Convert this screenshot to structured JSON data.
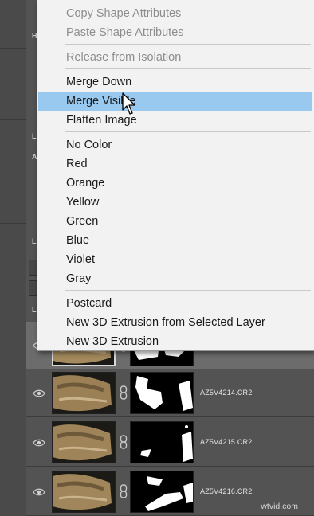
{
  "context_menu": {
    "items": [
      {
        "label": "Copy Shape Attributes",
        "disabled": true
      },
      {
        "label": "Paste Shape Attributes",
        "disabled": true
      },
      {
        "label": "Release from Isolation",
        "disabled": true
      },
      {
        "label": "Merge Down",
        "disabled": false
      },
      {
        "label": "Merge Visible",
        "disabled": false,
        "highlighted": true
      },
      {
        "label": "Flatten Image",
        "disabled": false
      },
      {
        "label": "No Color",
        "disabled": false
      },
      {
        "label": "Red",
        "disabled": false
      },
      {
        "label": "Orange",
        "disabled": false
      },
      {
        "label": "Yellow",
        "disabled": false
      },
      {
        "label": "Green",
        "disabled": false
      },
      {
        "label": "Blue",
        "disabled": false
      },
      {
        "label": "Violet",
        "disabled": false
      },
      {
        "label": "Gray",
        "disabled": false
      },
      {
        "label": "Postcard",
        "disabled": false
      },
      {
        "label": "New 3D Extrusion from Selected Layer",
        "disabled": false
      },
      {
        "label": "New 3D Extrusion",
        "disabled": false
      }
    ],
    "highlight_color": "#99c9ef"
  },
  "layers": [
    {
      "name": "",
      "selected": true
    },
    {
      "name": "AZ5V4214.CR2",
      "selected": false
    },
    {
      "name": "AZ5V4215.CR2",
      "selected": false
    },
    {
      "name": "AZ5V4216.CR2",
      "selected": false
    }
  ],
  "panel_letters": [
    "H",
    "L",
    "A",
    "L",
    "L"
  ],
  "watermark": "wtvid.com"
}
